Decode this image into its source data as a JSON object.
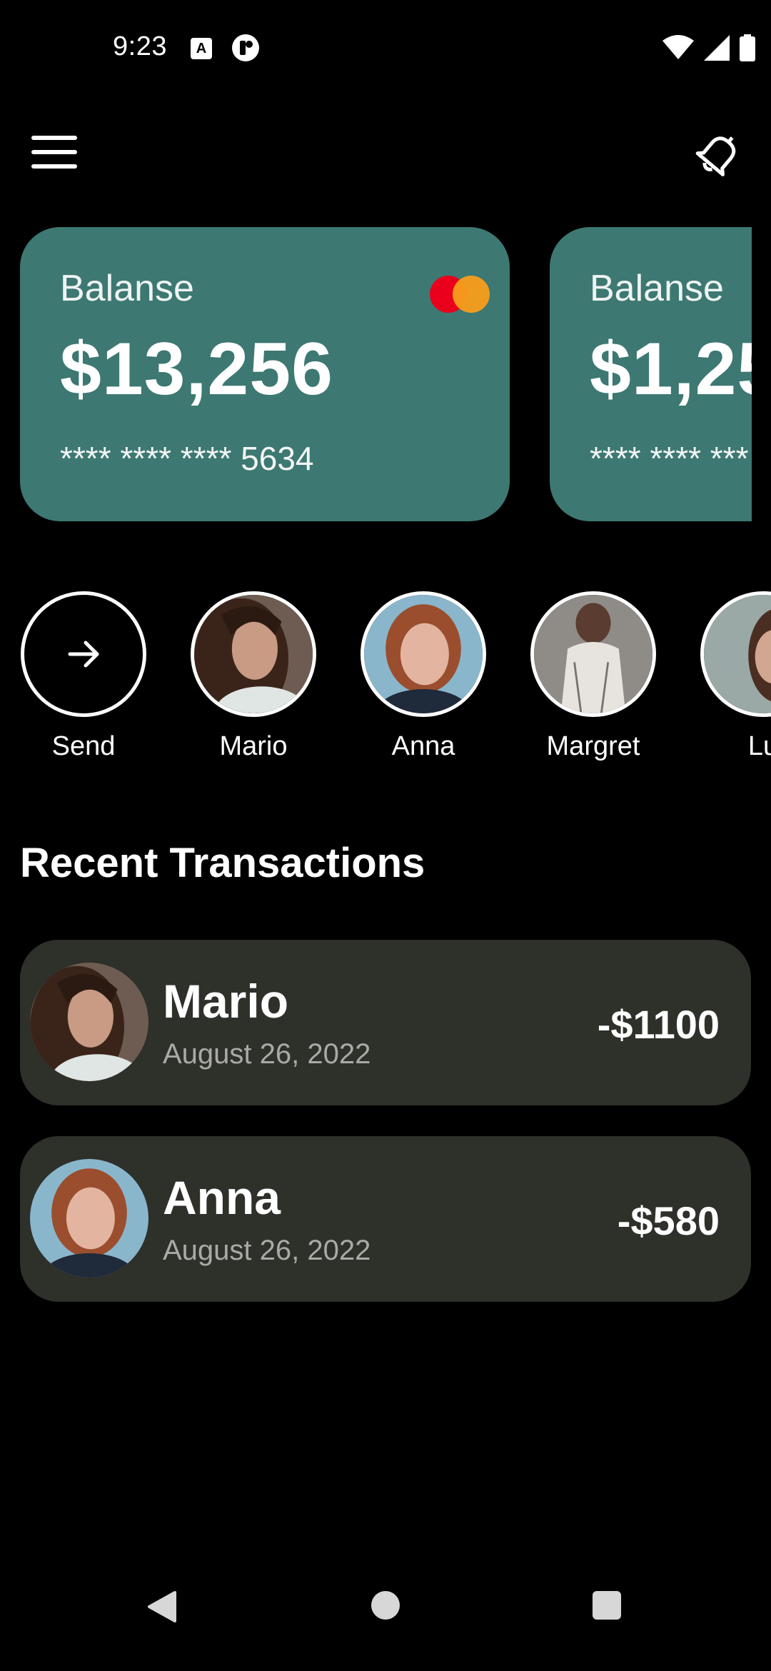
{
  "status_bar": {
    "time": "9:23",
    "icon_a_letter": "A"
  },
  "header": {
    "menu_icon": "hamburger-menu-icon",
    "bell_icon": "bell-icon"
  },
  "cards": [
    {
      "label": "Balanse",
      "amount": "$13,256",
      "number": "**** **** **** 5634",
      "brand": "mastercard"
    },
    {
      "label": "Balanse",
      "amount": "$1,25",
      "number": "**** **** ***"
    }
  ],
  "contacts": [
    {
      "name": "Send",
      "icon": "arrow-right-icon"
    },
    {
      "name": "Mario"
    },
    {
      "name": "Anna"
    },
    {
      "name": "Margret"
    },
    {
      "name": "Lu"
    }
  ],
  "section": {
    "title": "Recent Transactions"
  },
  "transactions": [
    {
      "name": "Mario",
      "date": "August 26, 2022",
      "amount": "-$1100"
    },
    {
      "name": "Anna",
      "date": "August 26, 2022",
      "amount": "-$580"
    }
  ],
  "colors": {
    "background": "#000000",
    "card": "#3d7872",
    "transaction_bg": "#2e302a",
    "muted_text": "#a9aaa5"
  }
}
